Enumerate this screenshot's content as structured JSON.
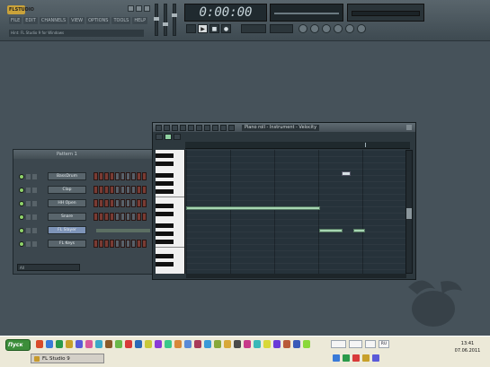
{
  "app": {
    "logo": "FLSTUDIO",
    "hint_text": "Hint: FL Studio 9 for Windows"
  },
  "menu": [
    "FILE",
    "EDIT",
    "CHANNELS",
    "VIEW",
    "OPTIONS",
    "TOOLS",
    "HELP"
  ],
  "transport": {
    "time": "0:00:00",
    "play_icon": "play-icon",
    "stop_icon": "stop-icon",
    "record_icon": "record-icon"
  },
  "channel_rack": {
    "title": "Pattern 1",
    "channels": [
      "BassDrum",
      "Clap",
      "HH Open",
      "Snare",
      "FL Slayer",
      "FL Keys"
    ],
    "selected_index": 4,
    "bottom_label": "All"
  },
  "piano_roll": {
    "title": "Piano roll - Instrument - Velocity",
    "note_count": 4
  },
  "taskbar": {
    "start_label": "Пуск",
    "task_label": "FL Studio 9",
    "lang": "RU",
    "clock_time": "13:41",
    "clock_date": "07.06.2011"
  },
  "colors": {
    "note_green": "#a6d6b2",
    "selected_channel": "#7e94b8",
    "step_red": "#7a3b33",
    "taskbar": "#ece9d8"
  }
}
